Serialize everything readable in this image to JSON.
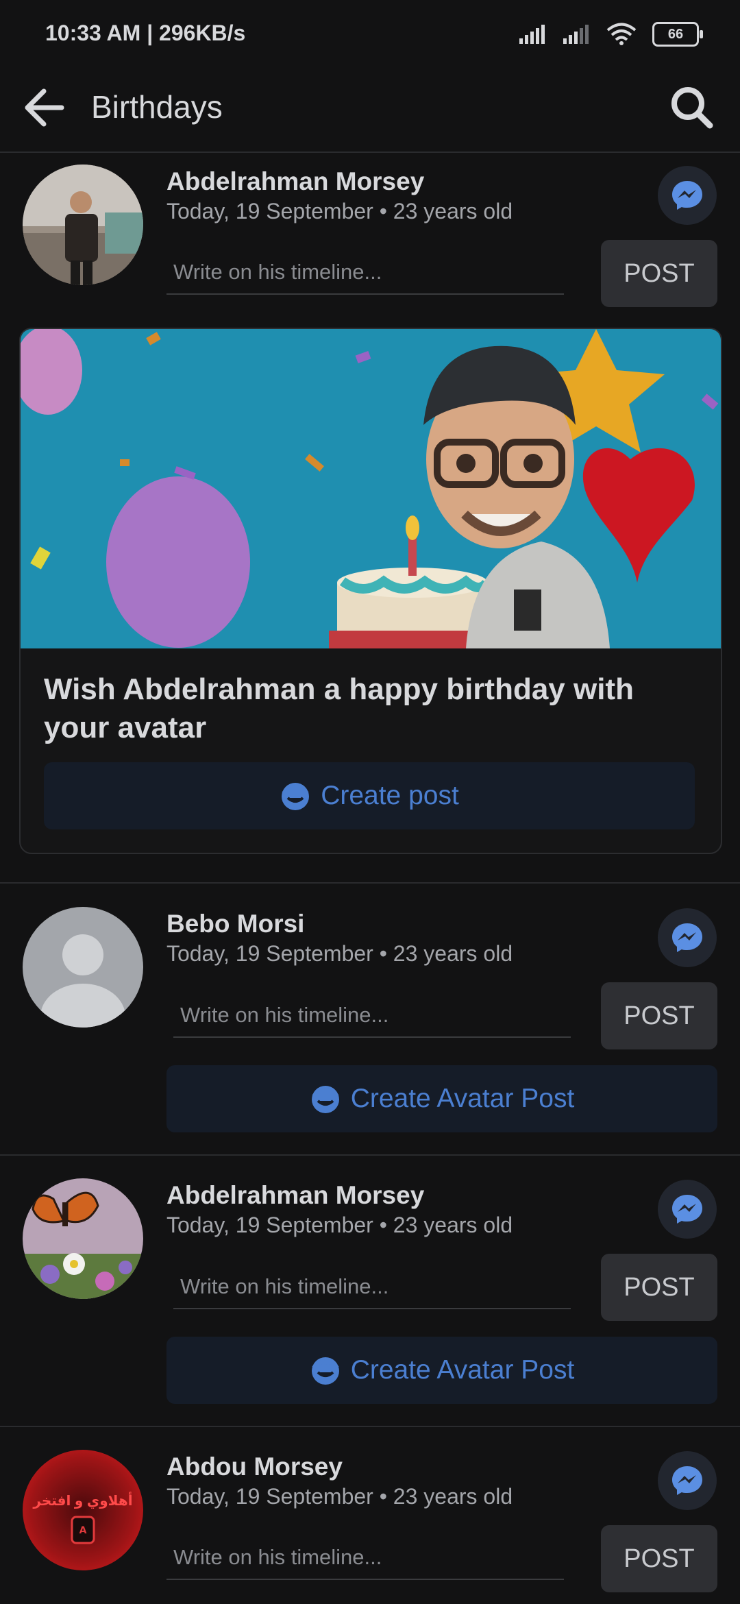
{
  "status_bar": {
    "time_speed": "10:33 AM | 296KB/s",
    "battery": "66"
  },
  "header": {
    "title": "Birthdays"
  },
  "entries": [
    {
      "name": "Abdelrahman Morsey",
      "subtitle": "Today, 19 September • 23 years old",
      "placeholder": "Write on his timeline...",
      "post_label": "POST"
    },
    {
      "name": "Bebo Morsi",
      "subtitle": "Today, 19 September • 23 years old",
      "placeholder": "Write on his timeline...",
      "post_label": "POST",
      "avatar_button": "Create Avatar Post"
    },
    {
      "name": "Abdelrahman Morsey",
      "subtitle": "Today, 19 September • 23 years old",
      "placeholder": "Write on his timeline...",
      "post_label": "POST",
      "avatar_button": "Create Avatar Post"
    },
    {
      "name": "Abdou Morsey",
      "subtitle": "Today, 19 September • 23 years old",
      "placeholder": "Write on his timeline...",
      "post_label": "POST",
      "avatar_text": "أهلاوي و افتخر"
    }
  ],
  "avatar_card": {
    "title": "Wish Abdelrahman a happy birthday with your avatar",
    "button": "Create post"
  },
  "colors": {
    "background": "#121213",
    "accent": "#4b7fd1",
    "button_bg": "#151c28"
  },
  "icons": [
    "back-arrow-icon",
    "search-icon",
    "messenger-icon",
    "avatar-face-icon"
  ]
}
